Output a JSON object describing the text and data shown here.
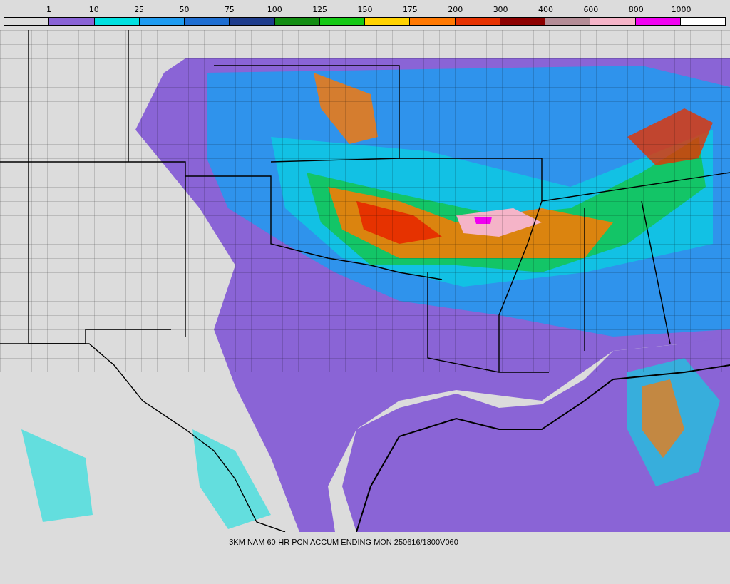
{
  "legend": {
    "labels": [
      "1",
      "10",
      "25",
      "50",
      "75",
      "100",
      "125",
      "150",
      "175",
      "200",
      "300",
      "400",
      "600",
      "800",
      "1000"
    ],
    "bins": [
      {
        "color": "#dcdcdc"
      },
      {
        "color": "#8a64d6"
      },
      {
        "color": "#00e0e0"
      },
      {
        "color": "#1e9bf0"
      },
      {
        "color": "#1e6ed2"
      },
      {
        "color": "#1e3c8c"
      },
      {
        "color": "#128c12"
      },
      {
        "color": "#14c814"
      },
      {
        "color": "#ffd200"
      },
      {
        "color": "#ff7800"
      },
      {
        "color": "#e63200"
      },
      {
        "color": "#8c0000"
      },
      {
        "color": "#b48c96"
      },
      {
        "color": "#f5b4c8"
      },
      {
        "color": "#f000f0"
      },
      {
        "color": "#ffffff"
      }
    ]
  },
  "caption": "3KM NAM 60-HR PCN ACCUM ENDING MON 250616/1800V060"
}
